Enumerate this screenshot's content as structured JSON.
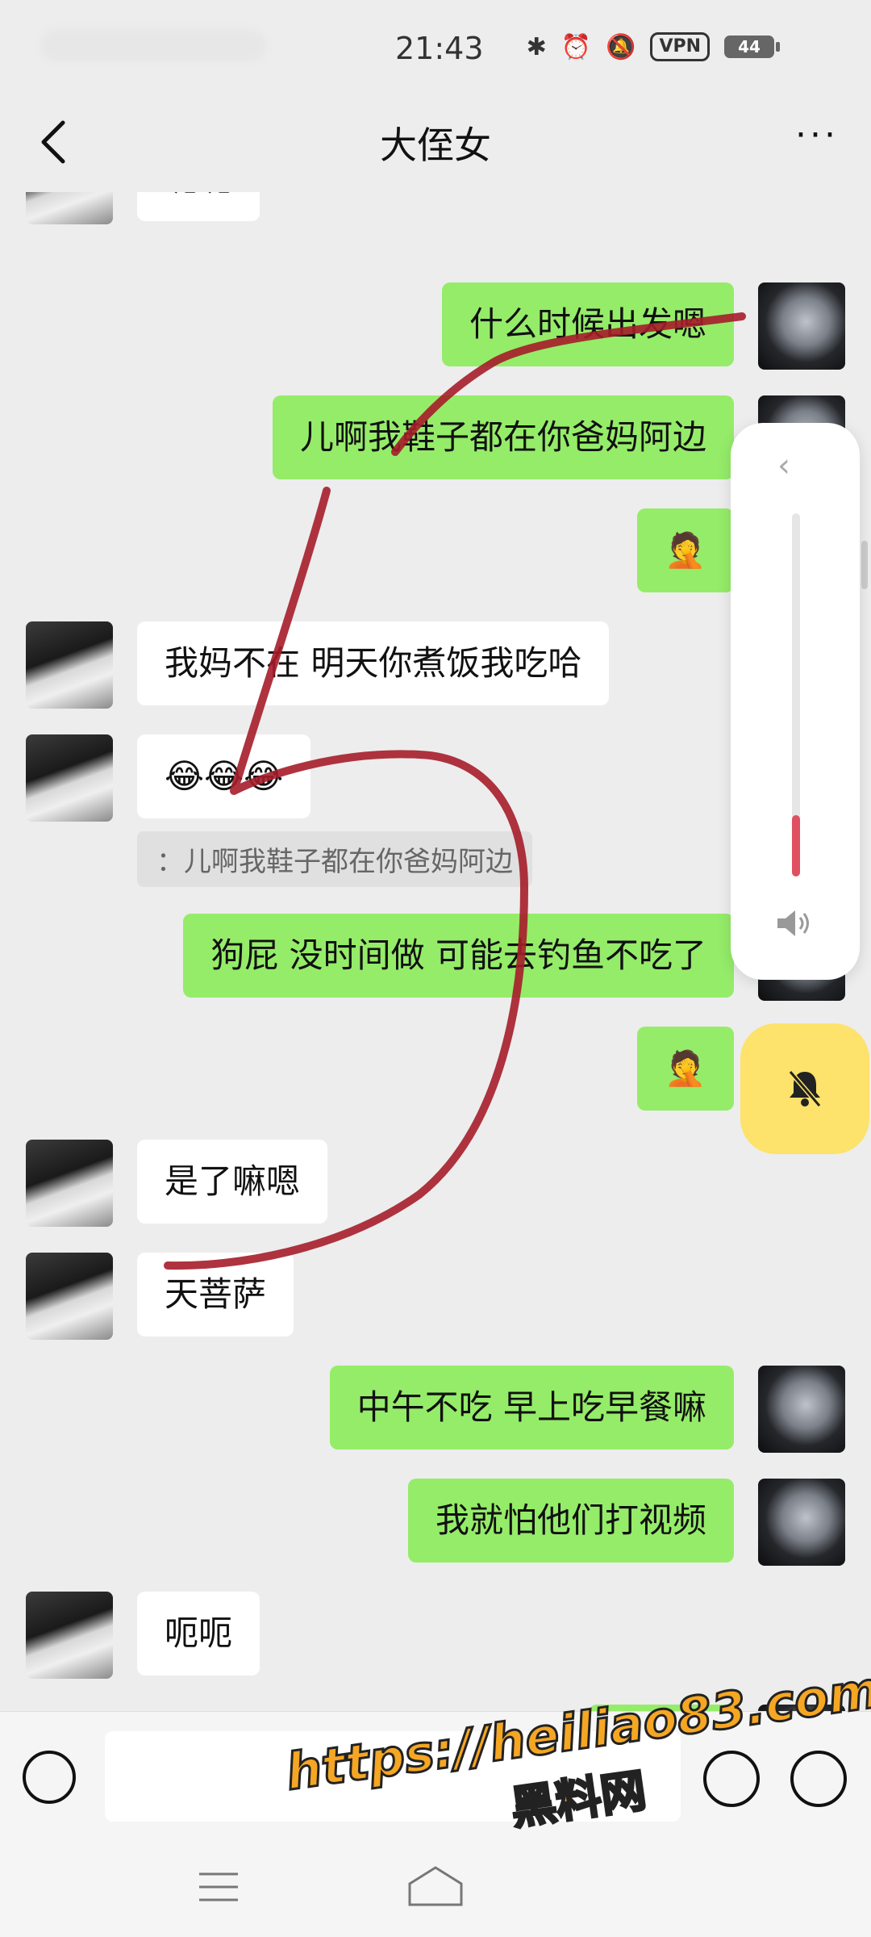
{
  "status_bar": {
    "time": "21:43",
    "vpn": "VPN",
    "battery": "44"
  },
  "header": {
    "title": "大侄女",
    "more": "···"
  },
  "messages": [
    {
      "side": "in",
      "text": "呃呃"
    },
    {
      "side": "out",
      "text": "什么时候出发嗯"
    },
    {
      "side": "out",
      "text": "儿啊我鞋子都在你爸妈阿边"
    },
    {
      "side": "out",
      "text": "🤦"
    },
    {
      "side": "in",
      "text": "我妈不在   明天你煮饭我吃哈"
    },
    {
      "side": "in",
      "text": "😂😂😂"
    },
    {
      "side": "quote",
      "text": "：儿啊我鞋子都在你爸妈阿边"
    },
    {
      "side": "out",
      "text": "狗屁 没时间做 可能去钓鱼不吃了"
    },
    {
      "side": "out",
      "text": "🤦"
    },
    {
      "side": "in",
      "text": "是了嘛嗯"
    },
    {
      "side": "in",
      "text": "天菩萨"
    },
    {
      "side": "out",
      "text": "中午不吃 早上吃早餐嘛"
    },
    {
      "side": "out",
      "text": "我就怕他们打视频"
    },
    {
      "side": "in",
      "text": "呃呃"
    }
  ],
  "volume": {
    "level": 0.17
  },
  "input": {
    "placeholder": ""
  },
  "watermark": {
    "url": "https://heiliao83.com",
    "name": "黑料网"
  },
  "colors": {
    "bubble_out": "#95ec69",
    "bubble_in": "#ffffff",
    "background": "#ededed",
    "mute_button": "#fde26b",
    "volume_fill": "#e05060",
    "scribble": "#a51d2a"
  }
}
